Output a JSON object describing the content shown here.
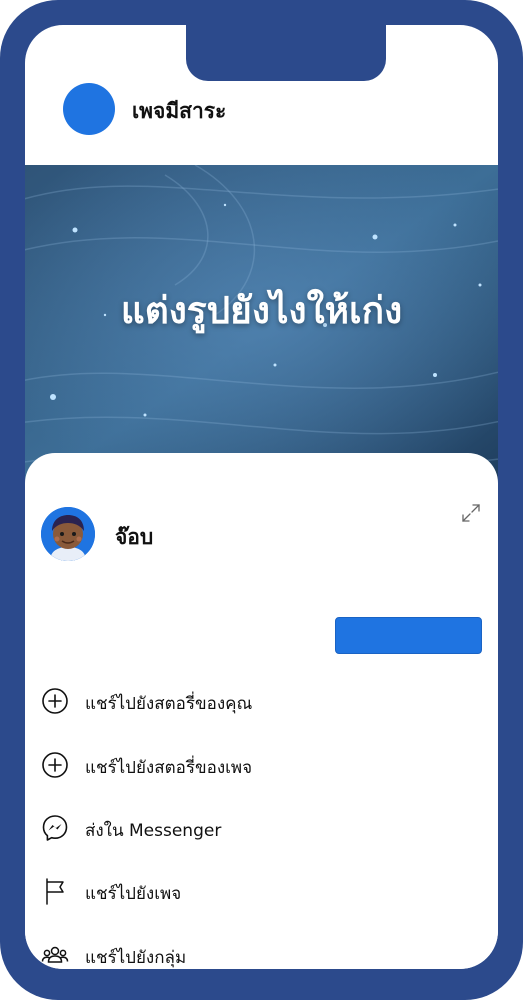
{
  "page": {
    "name": "เพจมีสาระ"
  },
  "banner": {
    "title": "แต่งรูปยังไงให้เก่ง"
  },
  "share_sheet": {
    "user_name": "จ๊อบ",
    "share_button_label": "",
    "menu": [
      {
        "icon": "plus-circle-icon",
        "label": "แชร์ไปยังสตอรี่ของคุณ"
      },
      {
        "icon": "plus-circle-icon",
        "label": "แชร์ไปยังสตอรี่ของเพจ"
      },
      {
        "icon": "messenger-icon",
        "label": "ส่งใน Messenger"
      },
      {
        "icon": "flag-icon",
        "label": "แชร์ไปยังเพจ"
      },
      {
        "icon": "group-icon",
        "label": "แชร์ไปยังกลุ่ม"
      }
    ]
  },
  "colors": {
    "frame": "#2c4a8c",
    "accent": "#1f74e1"
  }
}
